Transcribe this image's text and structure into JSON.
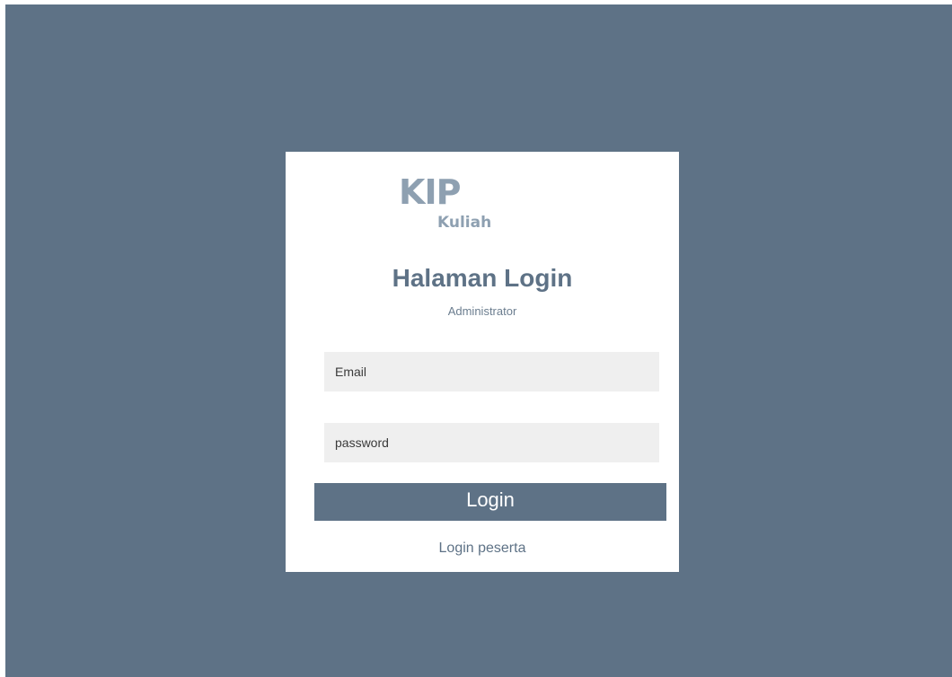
{
  "logo": {
    "line1": "KIP",
    "line2": "Kuliah"
  },
  "login_card": {
    "title": "Halaman Login",
    "subtitle": "Administrator",
    "email_placeholder": "Email",
    "password_placeholder": "password",
    "login_button_label": "Login",
    "peserta_link_label": "Login peserta"
  },
  "colors": {
    "background": "#5e7286",
    "card": "#ffffff",
    "input_bg": "#efefef",
    "button": "#5e7286",
    "logo": "#8ea0b1"
  }
}
